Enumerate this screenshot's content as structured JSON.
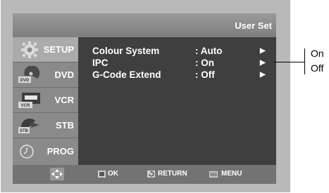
{
  "header": {
    "title": "User Set"
  },
  "nav": [
    {
      "label": "SETUP",
      "icon": "gear-icon",
      "active": true
    },
    {
      "label": "DVD",
      "icon": "dvd-disc-icon",
      "active": false
    },
    {
      "label": "VCR",
      "icon": "vcr-tape-icon",
      "active": false
    },
    {
      "label": "STB",
      "icon": "stb-dish-icon",
      "active": false
    },
    {
      "label": "PROG",
      "icon": "clock-icon",
      "active": false
    }
  ],
  "settings": [
    {
      "label": "Colour System",
      "value": ": Auto",
      "arrow": "▶"
    },
    {
      "label": "IPC",
      "value": ": On",
      "arrow": "▶"
    },
    {
      "label": "G-Code Extend",
      "value": ": Off",
      "arrow": "▶"
    }
  ],
  "footer": {
    "ok": "OK",
    "return": "RETURN",
    "menu": "MENU"
  },
  "callout": {
    "options": [
      "On",
      "Off"
    ]
  },
  "icon_badges": {
    "dvd": "DVD",
    "vcr": "VCR",
    "stb": "STB"
  },
  "colors": {
    "frame": "#4a4a4a",
    "title_bar": "#8b8b8b",
    "nav_active": "#ababab",
    "nav_inactive": "#8a8a8a",
    "panel": "#3f3f3f",
    "text": "#ffffff"
  }
}
